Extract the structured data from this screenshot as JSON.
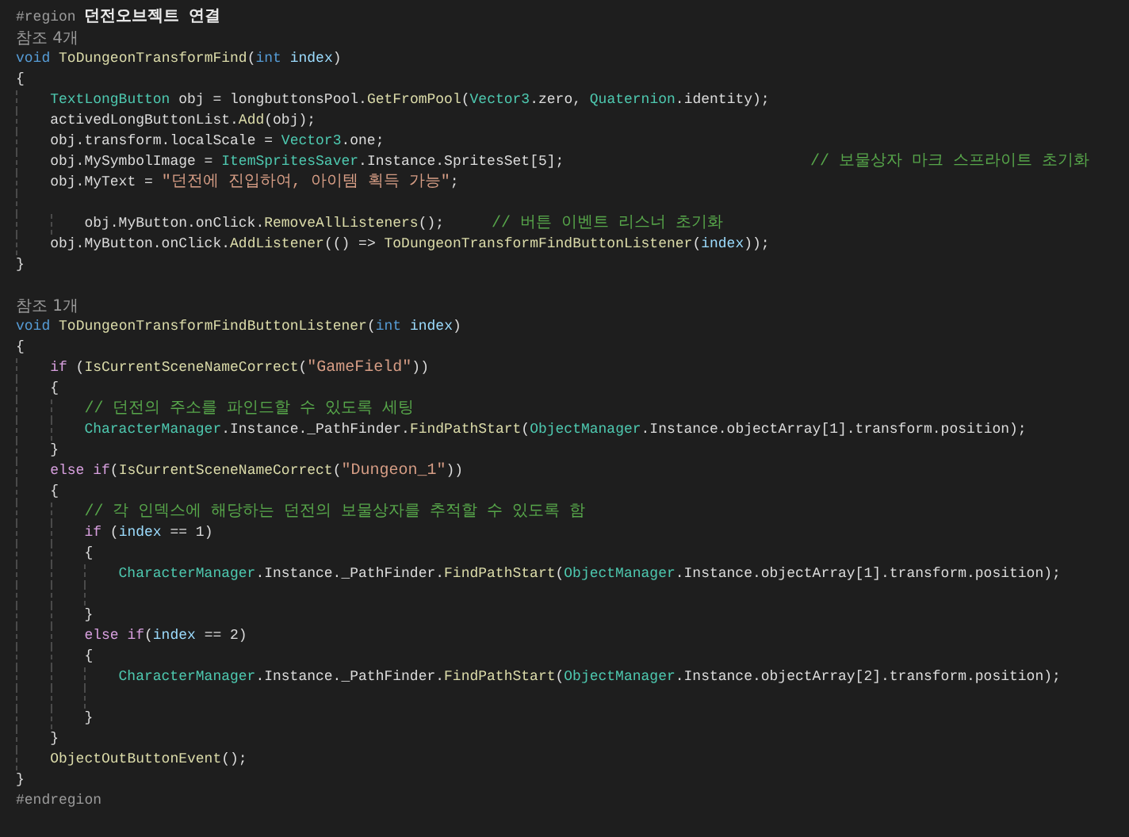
{
  "editor": {
    "lines": [
      {
        "kind": "code",
        "tokens": [
          {
            "kind": "pre",
            "text": "#region "
          },
          {
            "kind": "heading",
            "text": "던전오브젝트 연결"
          }
        ]
      },
      {
        "kind": "codelens",
        "text": "참조 4개"
      },
      {
        "kind": "code",
        "tokens": [
          {
            "kind": "kw",
            "text": "void "
          },
          {
            "kind": "fn",
            "text": "ToDungeonTransformFind"
          },
          {
            "kind": "plain",
            "text": "("
          },
          {
            "kind": "kw",
            "text": "int "
          },
          {
            "kind": "var",
            "text": "index"
          },
          {
            "kind": "plain",
            "text": ")"
          }
        ]
      },
      {
        "kind": "code",
        "tokens": [
          {
            "kind": "plain",
            "text": "{"
          }
        ],
        "children": [
          {
            "kind": "code",
            "tokens": [
              {
                "kind": "type",
                "text": "TextLongButton"
              },
              {
                "kind": "plain",
                "text": " obj = longbuttonsPool."
              },
              {
                "kind": "fn",
                "text": "GetFromPool"
              },
              {
                "kind": "plain",
                "text": "("
              },
              {
                "kind": "type",
                "text": "Vector3"
              },
              {
                "kind": "plain",
                "text": ".zero, "
              },
              {
                "kind": "type",
                "text": "Quaternion"
              },
              {
                "kind": "plain",
                "text": ".identity);"
              }
            ]
          },
          {
            "kind": "code",
            "tokens": [
              {
                "kind": "plain",
                "text": "activedLongButtonList."
              },
              {
                "kind": "fn",
                "text": "Add"
              },
              {
                "kind": "plain",
                "text": "(obj);"
              }
            ]
          },
          {
            "kind": "code",
            "tokens": [
              {
                "kind": "plain",
                "text": "obj.transform.localScale = "
              },
              {
                "kind": "type",
                "text": "Vector3"
              },
              {
                "kind": "plain",
                "text": ".one;"
              }
            ]
          },
          {
            "kind": "code",
            "tokens": [
              {
                "kind": "plain",
                "text": "obj.MySymbolImage = "
              },
              {
                "kind": "type",
                "text": "ItemSpritesSaver"
              },
              {
                "kind": "plain",
                "text": ".Instance.SpritesSet[5];"
              },
              {
                "kind": "eol_cmt",
                "text": "// 보물상자 마크 스프라이트 초기화"
              }
            ]
          },
          {
            "kind": "code",
            "tokens": [
              {
                "kind": "plain",
                "text": "obj.MyText = "
              },
              {
                "kind": "str",
                "text": "\"던전에 진입하여, 아이템 획득 가능\""
              },
              {
                "kind": "plain",
                "text": ";"
              }
            ]
          },
          {
            "kind": "blank",
            "children": [
              {
                "kind": "code",
                "tokens": [
                  {
                    "kind": "plain",
                    "text": "obj.MyButton.onClick."
                  },
                  {
                    "kind": "fn",
                    "text": "RemoveAllListeners"
                  },
                  {
                    "kind": "plain",
                    "text": "();"
                  },
                  {
                    "kind": "cmt",
                    "text": "// 버튼 이벤트 리스너 초기화"
                  }
                ]
              }
            ]
          },
          {
            "kind": "code",
            "tokens": [
              {
                "kind": "plain",
                "text": "obj.MyButton.onClick."
              },
              {
                "kind": "fn",
                "text": "AddListener"
              },
              {
                "kind": "plain",
                "text": "(() => "
              },
              {
                "kind": "fn",
                "text": "ToDungeonTransformFindButtonListener"
              },
              {
                "kind": "plain",
                "text": "("
              },
              {
                "kind": "var",
                "text": "index"
              },
              {
                "kind": "plain",
                "text": "));"
              }
            ]
          }
        ]
      },
      {
        "kind": "code",
        "tokens": [
          {
            "kind": "plain",
            "text": "}"
          }
        ]
      },
      {
        "kind": "blank"
      },
      {
        "kind": "codelens",
        "text": "참조 1개"
      },
      {
        "kind": "code",
        "tokens": [
          {
            "kind": "kw",
            "text": "void "
          },
          {
            "kind": "fn",
            "text": "ToDungeonTransformFindButtonListener"
          },
          {
            "kind": "plain",
            "text": "("
          },
          {
            "kind": "kw",
            "text": "int "
          },
          {
            "kind": "var",
            "text": "index"
          },
          {
            "kind": "plain",
            "text": ")"
          }
        ]
      },
      {
        "kind": "code",
        "tokens": [
          {
            "kind": "plain",
            "text": "{"
          }
        ],
        "children": [
          {
            "kind": "code",
            "tokens": [
              {
                "kind": "ctl",
                "text": "if"
              },
              {
                "kind": "plain",
                "text": " ("
              },
              {
                "kind": "fn",
                "text": "IsCurrentSceneNameCorrect"
              },
              {
                "kind": "plain",
                "text": "("
              },
              {
                "kind": "str",
                "text": "\"GameField\""
              },
              {
                "kind": "plain",
                "text": "))"
              }
            ]
          },
          {
            "kind": "code",
            "tokens": [
              {
                "kind": "plain",
                "text": "{"
              }
            ],
            "children": [
              {
                "kind": "code",
                "tokens": [
                  {
                    "kind": "cmt",
                    "text": "// 던전의 주소를 파인드할 수 있도록 세팅"
                  }
                ]
              },
              {
                "kind": "code",
                "tokens": [
                  {
                    "kind": "type",
                    "text": "CharacterManager"
                  },
                  {
                    "kind": "plain",
                    "text": ".Instance._PathFinder."
                  },
                  {
                    "kind": "fn",
                    "text": "FindPathStart"
                  },
                  {
                    "kind": "plain",
                    "text": "("
                  },
                  {
                    "kind": "type",
                    "text": "ObjectManager"
                  },
                  {
                    "kind": "plain",
                    "text": ".Instance.objectArray[1].transform.position);"
                  }
                ]
              }
            ]
          },
          {
            "kind": "code",
            "tokens": [
              {
                "kind": "plain",
                "text": "}"
              }
            ]
          },
          {
            "kind": "code",
            "tokens": [
              {
                "kind": "ctl",
                "text": "else if"
              },
              {
                "kind": "plain",
                "text": "("
              },
              {
                "kind": "fn",
                "text": "IsCurrentSceneNameCorrect"
              },
              {
                "kind": "plain",
                "text": "("
              },
              {
                "kind": "str",
                "text": "\"Dungeon_1\""
              },
              {
                "kind": "plain",
                "text": "))"
              }
            ]
          },
          {
            "kind": "code",
            "tokens": [
              {
                "kind": "plain",
                "text": "{"
              }
            ],
            "children": [
              {
                "kind": "code",
                "tokens": [
                  {
                    "kind": "cmt",
                    "text": "// 각 인덱스에 해당하는 던전의 보물상자를 추적할 수 있도록 함"
                  }
                ]
              },
              {
                "kind": "code",
                "tokens": [
                  {
                    "kind": "ctl",
                    "text": "if"
                  },
                  {
                    "kind": "plain",
                    "text": " ("
                  },
                  {
                    "kind": "var",
                    "text": "index"
                  },
                  {
                    "kind": "plain",
                    "text": " == 1)"
                  }
                ]
              },
              {
                "kind": "code",
                "tokens": [
                  {
                    "kind": "plain",
                    "text": "{"
                  }
                ],
                "children": [
                  {
                    "kind": "code",
                    "tokens": [
                      {
                        "kind": "type",
                        "text": "CharacterManager"
                      },
                      {
                        "kind": "plain",
                        "text": ".Instance._PathFinder."
                      },
                      {
                        "kind": "fn",
                        "text": "FindPathStart"
                      },
                      {
                        "kind": "plain",
                        "text": "("
                      },
                      {
                        "kind": "type",
                        "text": "ObjectManager"
                      },
                      {
                        "kind": "plain",
                        "text": ".Instance.objectArray[1].transform.position);"
                      }
                    ]
                  },
                  {
                    "kind": "blank"
                  }
                ]
              },
              {
                "kind": "code",
                "tokens": [
                  {
                    "kind": "plain",
                    "text": "}"
                  }
                ]
              },
              {
                "kind": "code",
                "tokens": [
                  {
                    "kind": "ctl",
                    "text": "else if"
                  },
                  {
                    "kind": "plain",
                    "text": "("
                  },
                  {
                    "kind": "var",
                    "text": "index"
                  },
                  {
                    "kind": "plain",
                    "text": " == 2)"
                  }
                ]
              },
              {
                "kind": "code",
                "tokens": [
                  {
                    "kind": "plain",
                    "text": "{"
                  }
                ],
                "children": [
                  {
                    "kind": "code",
                    "tokens": [
                      {
                        "kind": "type",
                        "text": "CharacterManager"
                      },
                      {
                        "kind": "plain",
                        "text": ".Instance._PathFinder."
                      },
                      {
                        "kind": "fn",
                        "text": "FindPathStart"
                      },
                      {
                        "kind": "plain",
                        "text": "("
                      },
                      {
                        "kind": "type",
                        "text": "ObjectManager"
                      },
                      {
                        "kind": "plain",
                        "text": ".Instance.objectArray[2].transform.position);"
                      }
                    ]
                  },
                  {
                    "kind": "blank"
                  }
                ]
              },
              {
                "kind": "code",
                "tokens": [
                  {
                    "kind": "plain",
                    "text": "}"
                  }
                ]
              }
            ]
          },
          {
            "kind": "code",
            "tokens": [
              {
                "kind": "plain",
                "text": "}"
              }
            ]
          },
          {
            "kind": "code",
            "tokens": [
              {
                "kind": "fn",
                "text": "ObjectOutButtonEvent"
              },
              {
                "kind": "plain",
                "text": "();"
              }
            ]
          }
        ]
      },
      {
        "kind": "code",
        "tokens": [
          {
            "kind": "plain",
            "text": "}"
          }
        ]
      },
      {
        "kind": "code",
        "tokens": [
          {
            "kind": "pre",
            "text": "#endregion"
          }
        ]
      }
    ]
  }
}
